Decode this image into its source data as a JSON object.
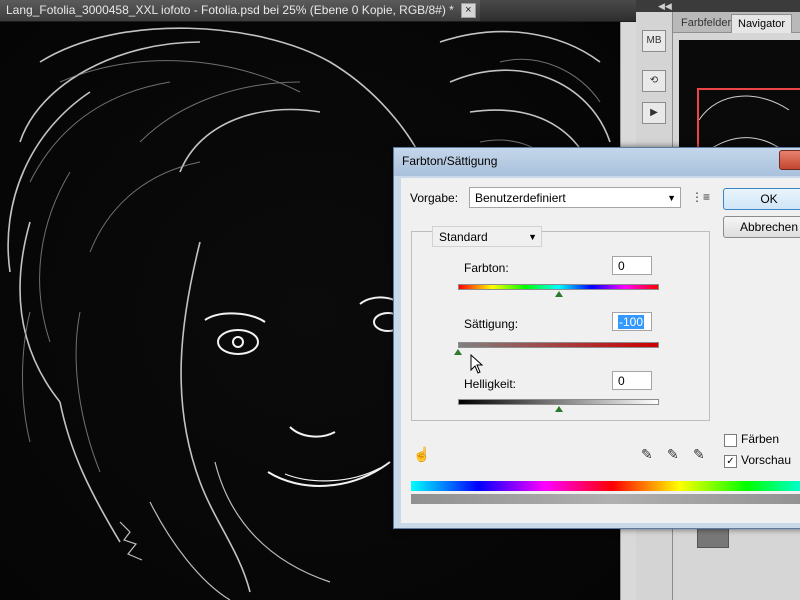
{
  "document": {
    "tab_title": "Lang_Fotolia_3000458_XXL iofoto - Fotolia.psd bei 25% (Ebene 0 Kopie, RGB/8#) *",
    "close_glyph": "×"
  },
  "panel": {
    "collapse_glyph": "◀◀",
    "tabs": [
      "Farbfelder",
      "Navigator"
    ],
    "active_tab": "Navigator",
    "strip_icons": [
      "mini-bridge-icon",
      "history-icon",
      "actions-play-icon"
    ],
    "strip_labels": [
      "MB",
      "⟲",
      "▶"
    ]
  },
  "dialog": {
    "title": "Farbton/Sättigung",
    "preset_label": "Vorgabe:",
    "preset_value": "Benutzerdefiniert",
    "ok_label": "OK",
    "cancel_label": "Abbrechen",
    "channel_value": "Standard",
    "hue": {
      "label": "Farbton:",
      "value": "0",
      "level": 0.5
    },
    "saturation": {
      "label": "Sättigung:",
      "value": "-100",
      "level": 0.0
    },
    "lightness": {
      "label": "Helligkeit:",
      "value": "0",
      "level": 0.5
    },
    "colorize_label": "Färben",
    "colorize_checked": false,
    "preview_label": "Vorschau",
    "preview_checked": true,
    "check_glyph": "✓",
    "dropdown_glyph": "▼"
  },
  "colors": {
    "dialog_frame": "#c9d9ea",
    "ok_border": "#3a84c8",
    "selection": "#3399ff",
    "thumb": "#2c7a2c"
  }
}
